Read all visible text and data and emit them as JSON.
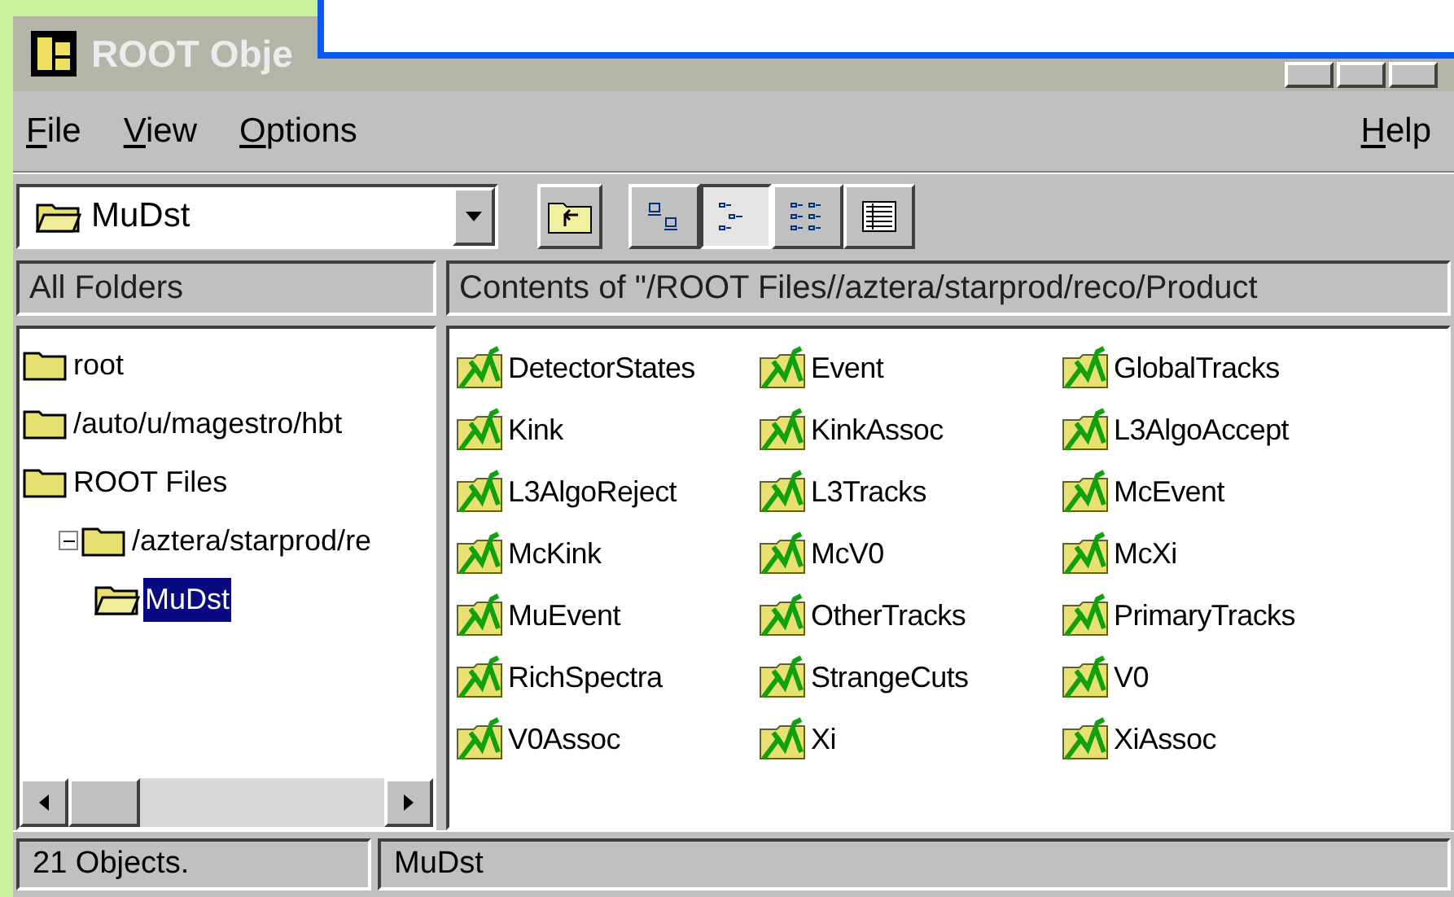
{
  "window": {
    "title": "ROOT Obje"
  },
  "menu": [
    {
      "hotkey": "F",
      "rest": "ile"
    },
    {
      "hotkey": "V",
      "rest": "iew"
    },
    {
      "hotkey": "O",
      "rest": "ptions"
    }
  ],
  "help_menu": {
    "hotkey": "H",
    "rest": "elp"
  },
  "location": {
    "value": "MuDst"
  },
  "view_buttons": [
    {
      "kind": "large",
      "selected": false
    },
    {
      "kind": "small",
      "selected": true
    },
    {
      "kind": "list",
      "selected": false
    },
    {
      "kind": "details",
      "selected": false
    }
  ],
  "left_header": "All Folders",
  "right_header": "Contents of \"/ROOT Files//aztera/starprod/reco/Product",
  "tree": [
    {
      "label": "root",
      "selected": false
    },
    {
      "label": "/auto/u/magestro/hbt",
      "selected": false
    },
    {
      "label": "ROOT Files",
      "selected": false,
      "children": [
        {
          "label": "/aztera/starprod/re",
          "selected": false,
          "expanded": true,
          "children": [
            {
              "label": "MuDst",
              "selected": true
            }
          ]
        }
      ]
    }
  ],
  "items": [
    {
      "label": "DetectorStates"
    },
    {
      "label": "Event"
    },
    {
      "label": "GlobalTracks"
    },
    {
      "label": "Kink"
    },
    {
      "label": "KinkAssoc"
    },
    {
      "label": "L3AlgoAccept"
    },
    {
      "label": "L3AlgoReject"
    },
    {
      "label": "L3Tracks"
    },
    {
      "label": "McEvent"
    },
    {
      "label": "McKink"
    },
    {
      "label": "McV0"
    },
    {
      "label": "McXi"
    },
    {
      "label": "MuEvent"
    },
    {
      "label": "OtherTracks"
    },
    {
      "label": "PrimaryTracks"
    },
    {
      "label": "RichSpectra"
    },
    {
      "label": "StrangeCuts"
    },
    {
      "label": "V0"
    },
    {
      "label": "V0Assoc"
    },
    {
      "label": "Xi"
    },
    {
      "label": "XiAssoc"
    }
  ],
  "status_bar": [
    "21 Objects.",
    "MuDst"
  ]
}
